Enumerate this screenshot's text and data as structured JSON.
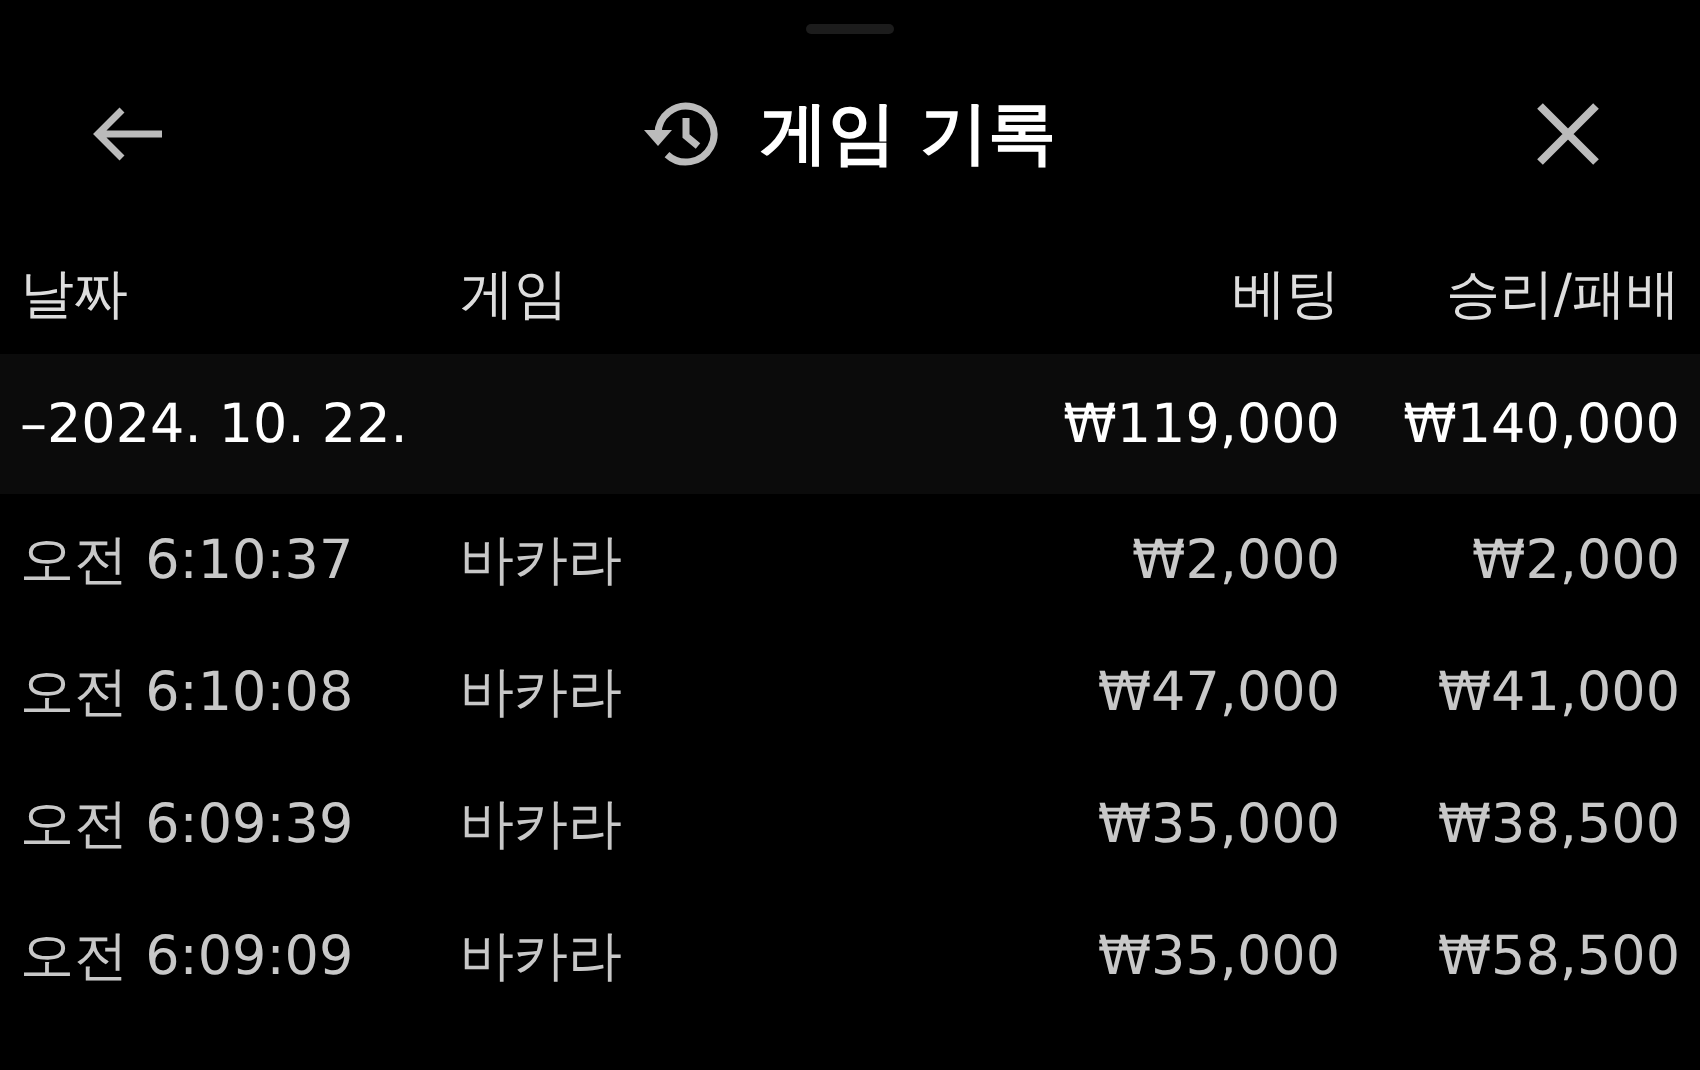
{
  "header": {
    "title": "게임 기록"
  },
  "table": {
    "columns": [
      "날짜",
      "게임",
      "베팅",
      "승리/패배"
    ],
    "group": {
      "date": "–2024. 10. 22.",
      "bet": "₩119,000",
      "result": "₩140,000"
    },
    "rows": [
      {
        "time": "오전 6:10:37",
        "game": "바카라",
        "bet": "₩2,000",
        "result": "₩2,000"
      },
      {
        "time": "오전 6:10:08",
        "game": "바카라",
        "bet": "₩47,000",
        "result": "₩41,000"
      },
      {
        "time": "오전 6:09:39",
        "game": "바카라",
        "bet": "₩35,000",
        "result": "₩38,500"
      },
      {
        "time": "오전 6:09:09",
        "game": "바카라",
        "bet": "₩35,000",
        "result": "₩58,500"
      }
    ]
  }
}
